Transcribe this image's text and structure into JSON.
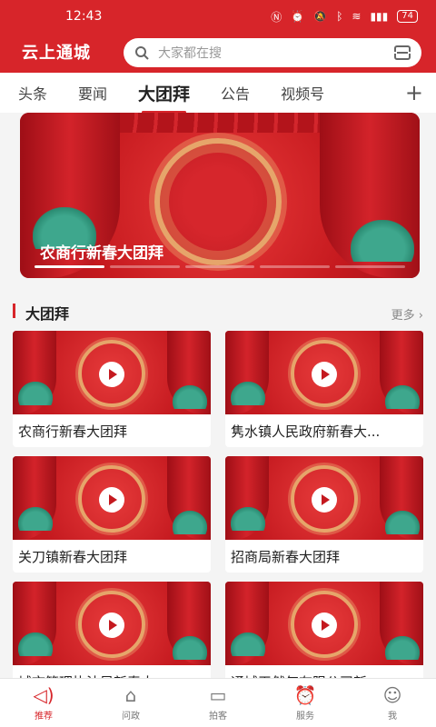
{
  "status": {
    "time": "12:43",
    "battery": "74"
  },
  "header": {
    "app_title": "云上通城",
    "search_placeholder": "大家都在搜"
  },
  "tabs": [
    {
      "label": "头条"
    },
    {
      "label": "要闻"
    },
    {
      "label": "大团拜",
      "active": true
    },
    {
      "label": "公告"
    },
    {
      "label": "视频号"
    }
  ],
  "tabs_add": "+",
  "hero": {
    "caption": "农商行新春大团拜",
    "slides": 5,
    "active_slide": 0
  },
  "section": {
    "title": "大团拜",
    "more": "更多 ›"
  },
  "cards": [
    {
      "title": "农商行新春大团拜"
    },
    {
      "title": "隽水镇人民政府新春大..."
    },
    {
      "title": "关刀镇新春大团拜"
    },
    {
      "title": "招商局新春大团拜"
    },
    {
      "title": "城市管理执法局新春大..."
    },
    {
      "title": "通城天然气有限公司新..."
    }
  ],
  "bottom_nav": [
    {
      "label": "推荐",
      "icon": "speaker-icon",
      "active": true
    },
    {
      "label": "问政",
      "icon": "home-icon"
    },
    {
      "label": "拍客",
      "icon": "camera-icon"
    },
    {
      "label": "服务",
      "icon": "alarm-clock-icon"
    },
    {
      "label": "我",
      "icon": "user-icon"
    }
  ],
  "colors": {
    "brand": "#d7252a",
    "background": "#f4f4f4"
  }
}
